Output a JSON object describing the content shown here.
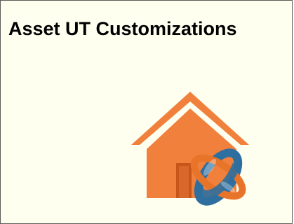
{
  "tile": {
    "title": "Asset UT Customizations",
    "icon": "home-asset-icon"
  },
  "colors": {
    "tile_background": "#fffff0",
    "tile_border": "#5a5a5a",
    "house_orange": "#f0803c",
    "house_door": "#c8561a",
    "ring_blue": "#2f6f9f",
    "ring_orange": "#e8742a"
  }
}
